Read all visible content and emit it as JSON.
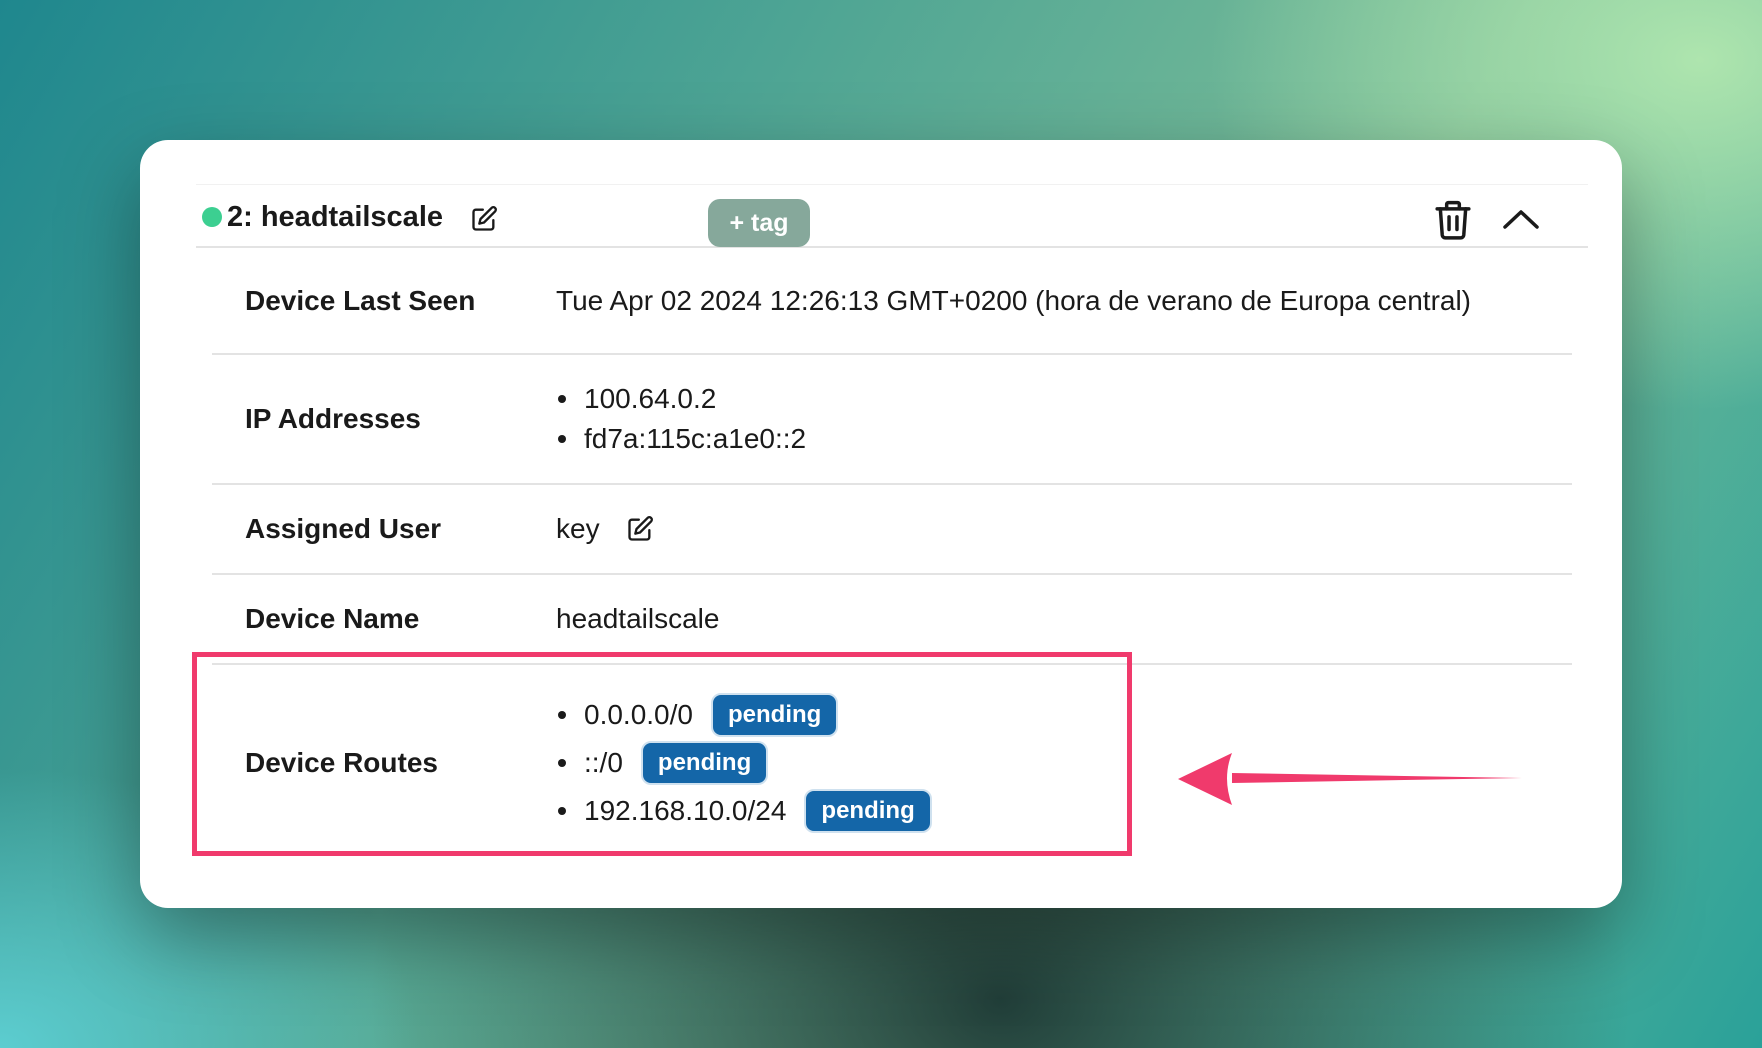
{
  "device": {
    "title": "2: headtailscale",
    "status": "online",
    "tag_button_label": "+ tag",
    "details": {
      "last_seen_label": "Device Last Seen",
      "last_seen_value": "Tue Apr 02 2024 12:26:13 GMT+0200 (hora de verano de Europa central)",
      "ip_label": "IP Addresses",
      "ip_addresses": [
        "100.64.0.2",
        "fd7a:115c:a1e0::2"
      ],
      "user_label": "Assigned User",
      "user_value": "key",
      "name_label": "Device Name",
      "name_value": "headtailscale",
      "routes_label": "Device Routes",
      "routes": [
        {
          "route": "0.0.0.0/0",
          "status": "pending"
        },
        {
          "route": "::/0",
          "status": "pending"
        },
        {
          "route": "192.168.10.0/24",
          "status": "pending"
        }
      ]
    }
  },
  "icons": {
    "edit": "edit-icon",
    "trash": "trash-icon",
    "collapse": "chevron-up-icon"
  },
  "colors": {
    "status_online": "#3ccf91",
    "tag_button": "#86a89b",
    "pending_badge": "#1466a8",
    "annotation": "#f03a6c"
  }
}
